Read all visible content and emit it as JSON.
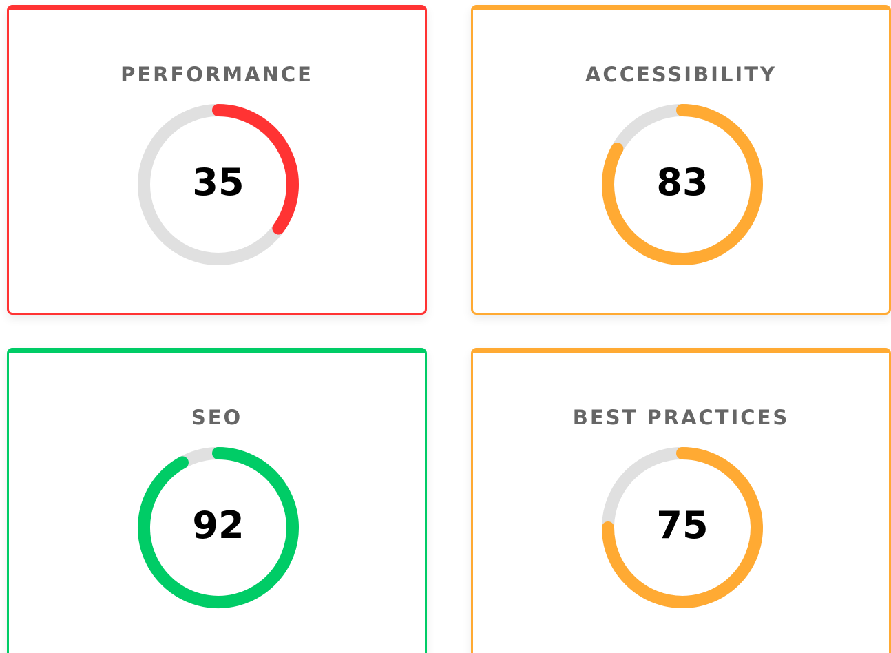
{
  "cards": [
    {
      "title": "PERFORMANCE",
      "score": 35,
      "color": "#ff3333"
    },
    {
      "title": "ACCESSIBILITY",
      "score": 83,
      "color": "#ffaa33"
    },
    {
      "title": "SEO",
      "score": 92,
      "color": "#00cc66"
    },
    {
      "title": "BEST PRACTICES",
      "score": 75,
      "color": "#ffaa33"
    }
  ],
  "track_color": "#e0e0e0"
}
